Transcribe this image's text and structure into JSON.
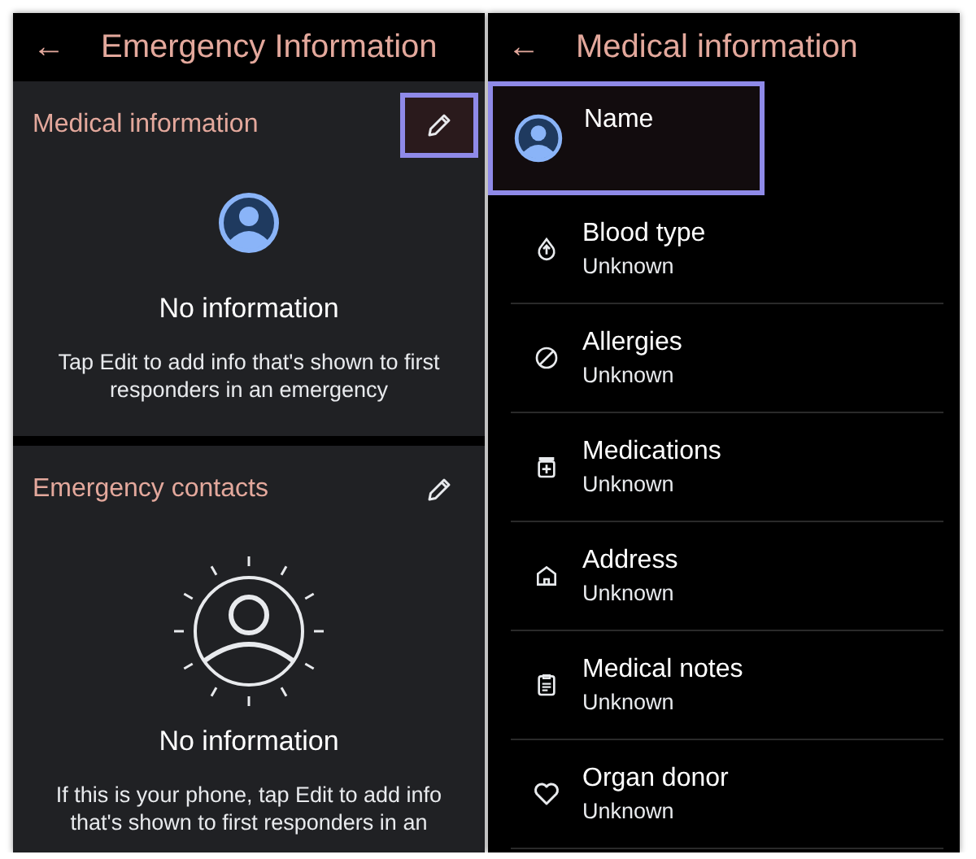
{
  "left_screen": {
    "back_icon": "←",
    "title": "Emergency Information",
    "sections": [
      {
        "kind": "medical",
        "title": "Medical information",
        "edit_highlighted": true,
        "empty_title": "No information",
        "empty_text": "Tap Edit to add info that's shown to first responders in an emergency"
      },
      {
        "kind": "contacts",
        "title": "Emergency contacts",
        "edit_highlighted": false,
        "empty_title": "No information",
        "empty_text": "If this is your phone, tap Edit to add info that's shown to first responders in an"
      }
    ]
  },
  "right_screen": {
    "back_icon": "←",
    "title": "Medical information",
    "items": [
      {
        "kind": "name",
        "label": "Name",
        "highlighted": true
      },
      {
        "kind": "blood",
        "label": "Blood type",
        "value": "Unknown",
        "highlighted": false
      },
      {
        "kind": "allergies",
        "label": "Allergies",
        "value": "Unknown",
        "highlighted": false
      },
      {
        "kind": "medications",
        "label": "Medications",
        "value": "Unknown",
        "highlighted": false
      },
      {
        "kind": "address",
        "label": "Address",
        "value": "Unknown",
        "highlighted": false
      },
      {
        "kind": "notes",
        "label": "Medical notes",
        "value": "Unknown",
        "highlighted": false
      },
      {
        "kind": "donor",
        "label": "Organ donor",
        "value": "Unknown",
        "highlighted": false
      }
    ]
  }
}
